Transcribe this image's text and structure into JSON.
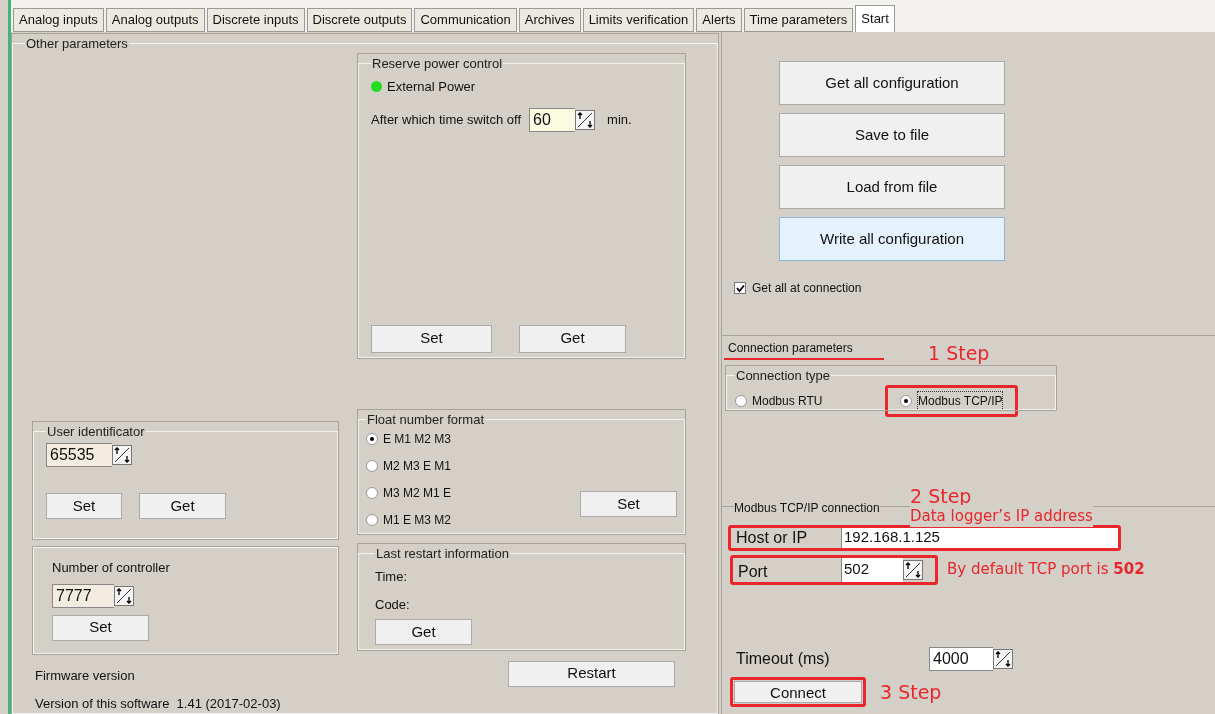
{
  "tabs": [
    {
      "label": "Analog inputs",
      "selected": false
    },
    {
      "label": "Analog outputs",
      "selected": false
    },
    {
      "label": "Discrete inputs",
      "selected": false
    },
    {
      "label": "Discrete outputs",
      "selected": false
    },
    {
      "label": "Communication",
      "selected": false
    },
    {
      "label": "Archives",
      "selected": false
    },
    {
      "label": "Limits verification",
      "selected": false
    },
    {
      "label": "Alerts",
      "selected": false
    },
    {
      "label": "Time parameters",
      "selected": false
    },
    {
      "label": "Start",
      "selected": true
    }
  ],
  "other_parameters": {
    "title": "Other parameters",
    "reserve_power": {
      "title": "Reserve power control",
      "indicator": {
        "label": "External Power",
        "color": "#22dd22"
      },
      "switch_off_label": "After which time switch off",
      "switch_off_value": "60",
      "unit": "min.",
      "buttons": [
        "Set",
        "Get"
      ]
    },
    "user_identificator": {
      "title": "User identificator",
      "value": "65535",
      "buttons": [
        "Set",
        "Get"
      ]
    },
    "float_format": {
      "title": "Float number format",
      "options": [
        {
          "label": "E M1 M2 M3",
          "selected": true
        },
        {
          "label": "M2 M3 E M1",
          "selected": false
        },
        {
          "label": "M3 M2 M1 E",
          "selected": false
        },
        {
          "label": "M1 E M3 M2",
          "selected": false
        }
      ],
      "button": "Set"
    },
    "number_of_controller": {
      "title": "Number of controller",
      "value": "7777",
      "button": "Set"
    },
    "last_restart": {
      "title": "Last restart information",
      "time_label": "Time:",
      "code_label": "Code:",
      "button": "Get"
    },
    "firmware_label": "Firmware version",
    "software_version": "Version of this software  1.41 (2017-02-03)",
    "restart_button": "Restart"
  },
  "actions": [
    {
      "label": "Get all configuration",
      "highlighted": false
    },
    {
      "label": "Save to file",
      "highlighted": false
    },
    {
      "label": "Load from file",
      "highlighted": false
    },
    {
      "label": "Write all configuration",
      "highlighted": true
    }
  ],
  "get_all_checkbox": {
    "label": "Get all at connection",
    "checked": true
  },
  "connection": {
    "title": "Connection parameters",
    "type_title": "Connection type",
    "types": [
      {
        "label": "Modbus RTU",
        "selected": false
      },
      {
        "label": "Modbus TCP/IP",
        "selected": true
      }
    ],
    "tcp_title": "Modbus TCP/IP connection",
    "host_label": "Host or IP",
    "host_value": "192.168.1.125",
    "port_label": "Port",
    "port_value": "502",
    "timeout_label": "Timeout (ms)",
    "timeout_value": "4000",
    "connect_button": "Connect"
  },
  "annotations": {
    "step1": "1 Step",
    "step2": "2 Step",
    "ip_note": "Data logger’s IP address",
    "port_note": "By default TCP port is **502**",
    "step3": "3 Step"
  }
}
